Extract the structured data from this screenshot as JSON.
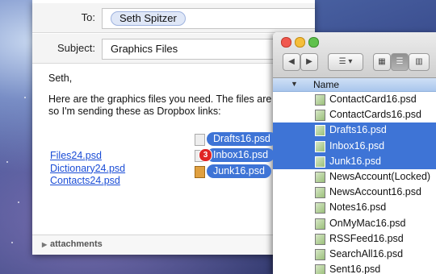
{
  "compose": {
    "to_label": "To:",
    "to_recipient": "Seth Spitzer",
    "subject_label": "Subject:",
    "subject_value": "Graphics Files",
    "greeting": "Seth,",
    "body_text": "Here are the graphics files you need.  The files are large, so I'm sending these as Dropbox links:",
    "links": [
      "Files24.psd",
      "Dictionary24.psd",
      "Contacts24.psd"
    ],
    "attachments_label": "attachments"
  },
  "drag": {
    "items": [
      "Drafts16.psd",
      "Inbox16.psd",
      "Junk16.psd"
    ],
    "count_badge": "3"
  },
  "finder": {
    "column_name": "Name",
    "files": [
      {
        "name": "ContactCard16.psd",
        "selected": false
      },
      {
        "name": "ContactCards16.psd",
        "selected": false
      },
      {
        "name": "Drafts16.psd",
        "selected": true
      },
      {
        "name": "Inbox16.psd",
        "selected": true
      },
      {
        "name": "Junk16.psd",
        "selected": true
      },
      {
        "name": "NewsAccount(Locked)",
        "selected": false
      },
      {
        "name": "NewsAccount16.psd",
        "selected": false
      },
      {
        "name": "Notes16.psd",
        "selected": false
      },
      {
        "name": "OnMyMac16.psd",
        "selected": false
      },
      {
        "name": "RSSFeed16.psd",
        "selected": false
      },
      {
        "name": "SearchAll16.psd",
        "selected": false
      },
      {
        "name": "Sent16.psd",
        "selected": false
      }
    ]
  },
  "colors": {
    "selection": "#3e74d6",
    "link": "#1b4dd6",
    "badge": "#e02424"
  }
}
